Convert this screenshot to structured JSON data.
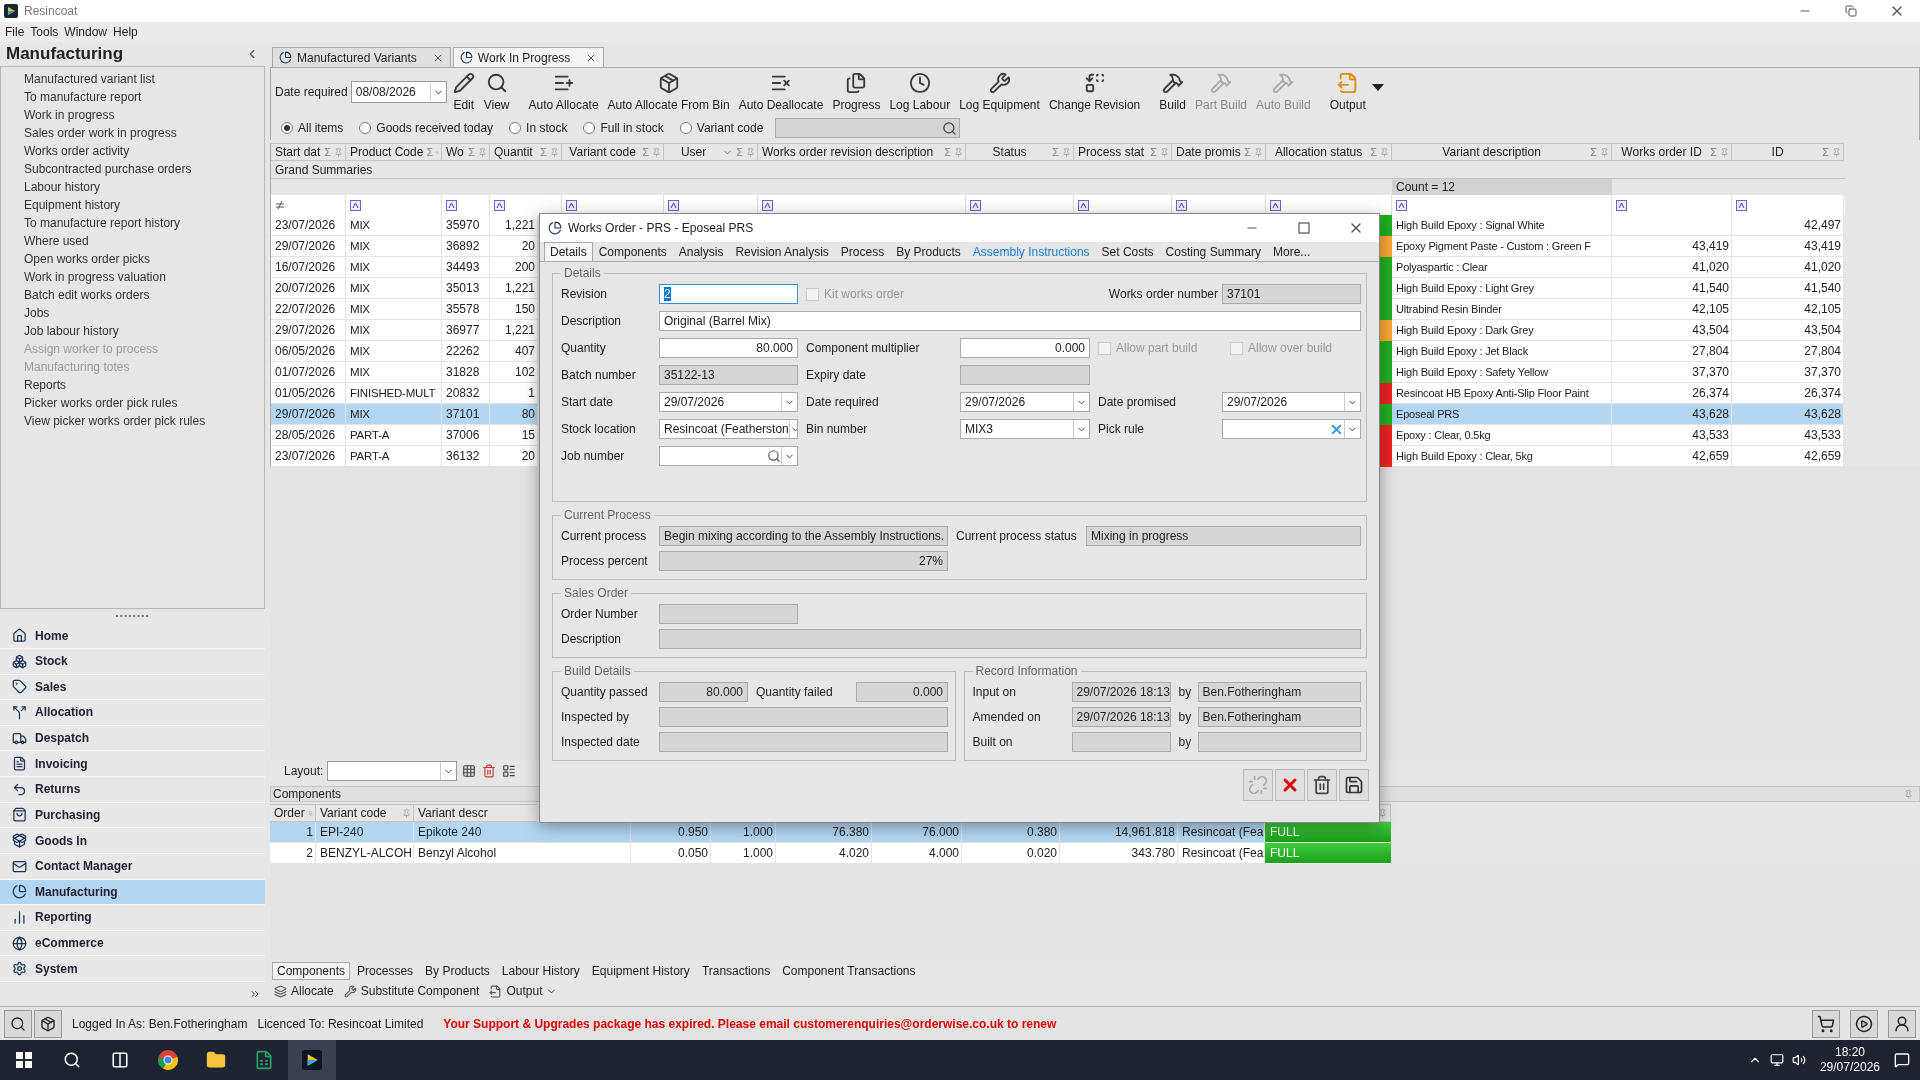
{
  "window": {
    "title": "Resincoat"
  },
  "menu": [
    "File",
    "Tools",
    "Window",
    "Help"
  ],
  "sidebar": {
    "title": "Manufacturing",
    "items": [
      {
        "label": "Manufactured variant list",
        "disabled": false
      },
      {
        "label": "To manufacture report",
        "disabled": false
      },
      {
        "label": "Work in progress",
        "disabled": false
      },
      {
        "label": "Sales order work in progress",
        "disabled": false
      },
      {
        "label": "Works order activity",
        "disabled": false
      },
      {
        "label": "Subcontracted purchase orders",
        "disabled": false
      },
      {
        "label": "Labour history",
        "disabled": false
      },
      {
        "label": "Equipment history",
        "disabled": false
      },
      {
        "label": "To manufacture report history",
        "disabled": false
      },
      {
        "label": "Where used",
        "disabled": false
      },
      {
        "label": "Open works order picks",
        "disabled": false
      },
      {
        "label": "Work in progress valuation",
        "disabled": false
      },
      {
        "label": "Batch edit works orders",
        "disabled": false
      },
      {
        "label": "Jobs",
        "disabled": false
      },
      {
        "label": "Job labour history",
        "disabled": false
      },
      {
        "label": "Assign worker to process",
        "disabled": true
      },
      {
        "label": "Manufacturing totes",
        "disabled": true
      },
      {
        "label": "Reports",
        "disabled": false
      },
      {
        "label": "Picker works order pick rules",
        "disabled": false
      },
      {
        "label": "View picker works order pick rules",
        "disabled": false
      }
    ],
    "nav": [
      {
        "label": "Home",
        "selected": false
      },
      {
        "label": "Stock",
        "selected": false
      },
      {
        "label": "Sales",
        "selected": false
      },
      {
        "label": "Allocation",
        "selected": false
      },
      {
        "label": "Despatch",
        "selected": false
      },
      {
        "label": "Invoicing",
        "selected": false
      },
      {
        "label": "Returns",
        "selected": false
      },
      {
        "label": "Purchasing",
        "selected": false
      },
      {
        "label": "Goods In",
        "selected": false
      },
      {
        "label": "Contact Manager",
        "selected": false
      },
      {
        "label": "Manufacturing",
        "selected": true
      },
      {
        "label": "Reporting",
        "selected": false
      },
      {
        "label": "eCommerce",
        "selected": false
      },
      {
        "label": "System",
        "selected": false
      }
    ]
  },
  "tabs": [
    {
      "label": "Manufactured Variants",
      "selected": false
    },
    {
      "label": "Work In Progress",
      "selected": true
    }
  ],
  "toolbar": {
    "date_label": "Date required",
    "date_value": "08/08/2026",
    "buttons": [
      {
        "label": "Edit",
        "disabled": false
      },
      {
        "label": "View",
        "disabled": false
      },
      {
        "label": "Auto Allocate",
        "disabled": false
      },
      {
        "label": "Auto Allocate From Bin",
        "disabled": false
      },
      {
        "label": "Auto Deallocate",
        "disabled": false
      },
      {
        "label": "Progress",
        "disabled": false
      },
      {
        "label": "Log Labour",
        "disabled": false
      },
      {
        "label": "Log Equipment",
        "disabled": false
      },
      {
        "label": "Change Revision",
        "disabled": false
      },
      {
        "label": "Build",
        "disabled": false
      },
      {
        "label": "Part Build",
        "disabled": true
      },
      {
        "label": "Auto Build",
        "disabled": true
      },
      {
        "label": "Output",
        "disabled": false
      }
    ]
  },
  "filters": [
    {
      "label": "All items",
      "selected": true
    },
    {
      "label": "Goods received today",
      "selected": false
    },
    {
      "label": "In stock",
      "selected": false
    },
    {
      "label": "Full in stock",
      "selected": false
    },
    {
      "label": "Variant code",
      "selected": false
    }
  ],
  "grid": {
    "columns": [
      {
        "label": "Start dat",
        "sum": "Σ"
      },
      {
        "label": "Product Code",
        "sum": "Σ"
      },
      {
        "label": "Wo",
        "sum": "Σ"
      },
      {
        "label": "Quantit",
        "sum": "Σ"
      },
      {
        "label": "Variant code",
        "sum": "Σ"
      },
      {
        "label": "User",
        "sum": "Σ"
      },
      {
        "label": "Works order revision description",
        "sum": "Σ"
      },
      {
        "label": "Status",
        "sum": "Σ"
      },
      {
        "label": "Process stat",
        "sum": "Σ"
      },
      {
        "label": "Date promis",
        "sum": "Σ"
      },
      {
        "label": "Allocation status",
        "sum": "Σ"
      },
      {
        "label": "Variant description",
        "sum": "Σ"
      },
      {
        "label": "Works order ID",
        "sum": "Σ"
      },
      {
        "label": "ID",
        "sum": "Σ"
      }
    ],
    "grand_summaries": "Grand Summaries",
    "count": "Count = 12",
    "rows": [
      {
        "start": "23/07/2026",
        "product": "MIX",
        "wo": "35970",
        "qty": "1,221",
        "color": "#22b022",
        "description": "High Build Epoxy : Signal White",
        "id": "42,497",
        "selected": false
      },
      {
        "start": "29/07/2026",
        "product": "MIX",
        "wo": "36892",
        "qty": "20",
        "color": "#ffa733",
        "description": "Epoxy Pigment Paste - Custom : Green F",
        "works_order_id": "43,419",
        "id": "43,419",
        "selected": false
      },
      {
        "start": "16/07/2026",
        "product": "MIX",
        "wo": "34493",
        "qty": "200",
        "color": "#22b022",
        "description": "Polyaspartic : Clear",
        "works_order_id": "41,020",
        "id": "41,020",
        "selected": false
      },
      {
        "start": "20/07/2026",
        "product": "MIX",
        "wo": "35013",
        "qty": "1,221",
        "color": "#22b022",
        "description": "High Build Epoxy : Light Grey",
        "works_order_id": "41,540",
        "id": "41,540",
        "selected": false
      },
      {
        "start": "22/07/2026",
        "product": "MIX",
        "wo": "35578",
        "qty": "150",
        "color": "#22b022",
        "description": "Ultrabind Resin Binder",
        "works_order_id": "42,105",
        "id": "42,105",
        "selected": false
      },
      {
        "start": "29/07/2026",
        "product": "MIX",
        "wo": "36977",
        "qty": "1,221",
        "color": "#ffa733",
        "description": "High Build Epoxy : Dark Grey",
        "works_order_id": "43,504",
        "id": "43,504",
        "selected": false
      },
      {
        "start": "06/05/2026",
        "product": "MIX",
        "wo": "22262",
        "qty": "407",
        "color": "#22b022",
        "description": "High Build Epoxy : Jet Black",
        "works_order_id": "27,804",
        "id": "27,804",
        "selected": false
      },
      {
        "start": "01/07/2026",
        "product": "MIX",
        "wo": "31828",
        "qty": "102",
        "color": "#22b022",
        "description": "High Build Epoxy : Safety Yellow",
        "works_order_id": "37,370",
        "id": "37,370",
        "selected": false
      },
      {
        "start": "01/05/2026",
        "product": "FINISHED-MULT",
        "wo": "20832",
        "qty": "1",
        "color": "#f02222",
        "description": "Resincoat HB Epoxy Anti-Slip Floor Paint",
        "works_order_id": "26,374",
        "id": "26,374",
        "selected": false
      },
      {
        "start": "29/07/2026",
        "product": "MIX",
        "wo": "37101",
        "qty": "80",
        "color": "#22b022",
        "description": "Eposeal PRS",
        "works_order_id": "43,628",
        "id": "43,628",
        "selected": true
      },
      {
        "start": "28/05/2026",
        "product": "PART-A",
        "wo": "37006",
        "qty": "15",
        "color": "#f02222",
        "description": "Epoxy : Clear, 0.5kg",
        "works_order_id": "43,533",
        "id": "43,533",
        "selected": false
      },
      {
        "start": "23/07/2026",
        "product": "PART-A",
        "wo": "36132",
        "qty": "20",
        "color": "#f02222",
        "description": "High Build Epoxy : Clear, 5kg",
        "works_order_id": "42,659",
        "id": "42,659",
        "selected": false
      }
    ]
  },
  "layout": {
    "label": "Layout:"
  },
  "components": {
    "title": "Components",
    "columns": [
      "Order",
      "Variant code",
      "Variant descr"
    ],
    "rows": [
      {
        "cells": [
          "1",
          "EPI-240",
          "Epikote 240",
          "0.950",
          "1.000",
          "76.380",
          "76.000",
          "0.380",
          "14,961.818",
          "Resincoat (Fea"
        ],
        "status": "FULL",
        "selected": true
      },
      {
        "cells": [
          "2",
          "BENZYL-ALCOH",
          "Benzyl Alcohol",
          "0.050",
          "1.000",
          "4.020",
          "4.000",
          "0.020",
          "343.780",
          "Resincoat (Fea"
        ],
        "status": "FULL",
        "selected": false
      }
    ]
  },
  "bottom_tabs": [
    {
      "label": "Components",
      "selected": true
    },
    {
      "label": "Processes",
      "selected": false
    },
    {
      "label": "By Products",
      "selected": false
    },
    {
      "label": "Labour History",
      "selected": false
    },
    {
      "label": "Equipment History",
      "selected": false
    },
    {
      "label": "Transactions",
      "selected": false
    },
    {
      "label": "Component Transactions",
      "selected": false
    }
  ],
  "bottom_actions": [
    "Allocate",
    "Substitute Component",
    "Output"
  ],
  "status_bar": {
    "logged_in": "Logged In As: Ben.Fotheringham",
    "licenced": "Licenced To: Resincoat Limited",
    "message": "Your Support & Upgrades package has expired. Please email customerenquiries@orderwise.co.uk to renew"
  },
  "taskbar": {
    "time": "18:20",
    "date": "29/07/2026"
  },
  "dialog": {
    "title": "Works Order - PRS - Eposeal PRS",
    "tabs": [
      {
        "label": "Details",
        "selected": true,
        "highlighted": false
      },
      {
        "label": "Components",
        "selected": false,
        "highlighted": false
      },
      {
        "label": "Analysis",
        "selected": false,
        "highlighted": false
      },
      {
        "label": "Revision Analysis",
        "selected": false,
        "highlighted": false
      },
      {
        "label": "Process",
        "selected": false,
        "highlighted": false
      },
      {
        "label": "By Products",
        "selected": false,
        "highlighted": false
      },
      {
        "label": "Assembly Instructions",
        "selected": false,
        "highlighted": true
      },
      {
        "label": "Set Costs",
        "selected": false,
        "highlighted": false
      },
      {
        "label": "Costing Summary",
        "selected": false,
        "highlighted": false
      },
      {
        "label": "More...",
        "selected": false,
        "highlighted": false
      }
    ],
    "details": {
      "title": "Details",
      "rows": [
        [
          {
            "kind": "text",
            "label": "Revision",
            "value": "2",
            "focused": true
          },
          {
            "kind": "checkbox",
            "label": "Kit works order",
            "checked": false,
            "disabled": true
          },
          {
            "kind": "readonly",
            "label": "Works order number",
            "value": "37101"
          }
        ],
        [
          {
            "kind": "longtext",
            "label": "Description",
            "value": "Original (Barrel Mix)"
          }
        ],
        [
          {
            "kind": "number",
            "label": "Quantity",
            "value": "80.000"
          },
          {
            "kind": "number",
            "label": "Component multiplier",
            "value": "0.000"
          },
          {
            "kind": "checkbox",
            "label": "Allow part build",
            "checked": false,
            "disabled": true
          },
          {
            "kind": "checkbox",
            "label": "Allow over build",
            "checked": false,
            "disabled": true
          }
        ],
        [
          {
            "kind": "readonly",
            "label": "Batch number",
            "value": "35122-13"
          },
          {
            "kind": "readonly",
            "label": "Expiry date"
          }
        ],
        [
          {
            "kind": "dropdown",
            "label": "Start date",
            "value": "29/07/2026"
          },
          {
            "kind": "dropdown",
            "label": "Date required",
            "value": "29/07/2026"
          },
          {
            "kind": "dropdown",
            "label": "Date promised",
            "value": "29/07/2026"
          }
        ],
        [
          {
            "kind": "dropdown",
            "label": "Stock location",
            "value": "Resincoat (Featherston"
          },
          {
            "kind": "dropdown",
            "label": "Bin number",
            "value": "MIX3"
          },
          {
            "kind": "clearable",
            "label": "Pick rule"
          }
        ],
        [
          {
            "kind": "lookup",
            "label": "Job number"
          }
        ]
      ]
    },
    "current_process": {
      "title": "Current Process",
      "process_label": "Current process",
      "process": "Begin mixing according to the Assembly Instructions.",
      "status_label": "Current process status",
      "status": "Mixing in progress",
      "percent_label": "Process percent",
      "percent": "27%"
    },
    "sales_order": {
      "title": "Sales Order",
      "order_label": "Order Number",
      "description_label": "Description"
    },
    "build": {
      "title": "Build Details",
      "passed_label": "Quantity passed",
      "passed": "80.000",
      "failed_label": "Quantity failed",
      "failed": "0.000",
      "inspected_by_label": "Inspected by",
      "inspected_date_label": "Inspected date"
    },
    "record": {
      "title": "Record Information",
      "rows": [
        {
          "label": "Input on",
          "value": "29/07/2026 18:13",
          "by": "by",
          "user": "Ben.Fotheringham"
        },
        {
          "label": "Amended on",
          "value": "29/07/2026 18:13",
          "by": "by",
          "user": "Ben.Fotheringham"
        },
        {
          "label": "Built on",
          "by": "by"
        }
      ]
    },
    "actions": [
      {
        "disabled": true
      },
      {
        "disabled": false
      },
      {
        "disabled": false
      },
      {
        "disabled": false
      }
    ]
  }
}
